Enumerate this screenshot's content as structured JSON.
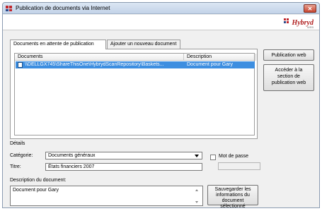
{
  "window": {
    "title": "Publication de documents via Internet"
  },
  "logo": {
    "text": "Hybryd",
    "subtext": "WEB"
  },
  "tabs": [
    {
      "label": "Documents en attente de publication",
      "active": true
    },
    {
      "label": "Ajouter un nouveau document",
      "active": false
    }
  ],
  "list": {
    "columns": [
      "Documents",
      "Description"
    ],
    "rows": [
      {
        "document": "\\\\DELLGX745\\ShareThisOne\\HybrydScanRepository\\Baskets...",
        "description": "Document pour Gary",
        "selected": true
      }
    ]
  },
  "buttons": {
    "publish": "Publication web",
    "access_line1": "Accéder à la",
    "access_line2": "section de",
    "access_line3": "publication web",
    "save_line1": "Sauvegarder les",
    "save_line2": "informations du",
    "save_line3": "document sélectionné"
  },
  "details": {
    "heading": "Détails",
    "category_label": "Catégorie:",
    "category_value": "Documents généraux",
    "password_label": "Mot de passe",
    "password_checked": false,
    "title_label": "Titre:",
    "title_value": "États financiers 2007",
    "description_label": "Description du document:",
    "description_value": "Document pour Gary"
  },
  "colors": {
    "selection": "#3d8ee0",
    "logo": "#b01e1e",
    "close": "#c8452f"
  }
}
